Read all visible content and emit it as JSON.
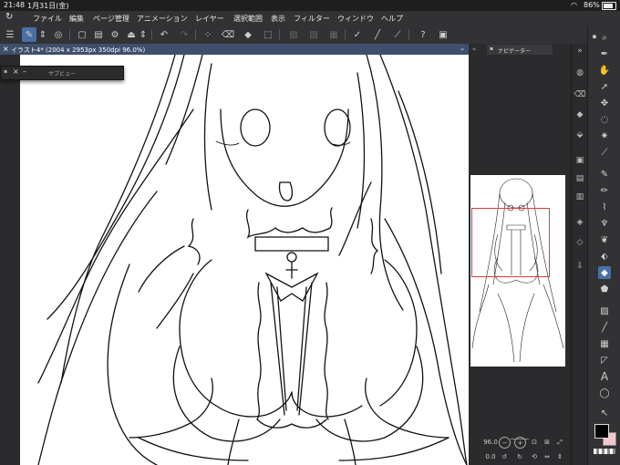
{
  "status": {
    "time": "21:48",
    "date": "1月31日(金)",
    "battery": "86%"
  },
  "menu": [
    "ファイル",
    "編集",
    "ページ管理",
    "アニメーション",
    "レイヤー",
    "選択範囲",
    "表示",
    "フィルター",
    "ウィンドウ",
    "ヘルプ"
  ],
  "document_tab": "イラスト4* (2004 x 2953px 350dpi 96.0%)",
  "subview_title": "サブビュー",
  "navigator_title": "ナビゲーター",
  "navigator": {
    "zoom": "96.0",
    "rotation": "0.0"
  },
  "colors": {
    "accent": "#4b6fa5",
    "main_color": "#000000",
    "sub_color": "#f4c6cc",
    "nav_frame": "#e23b3b"
  }
}
